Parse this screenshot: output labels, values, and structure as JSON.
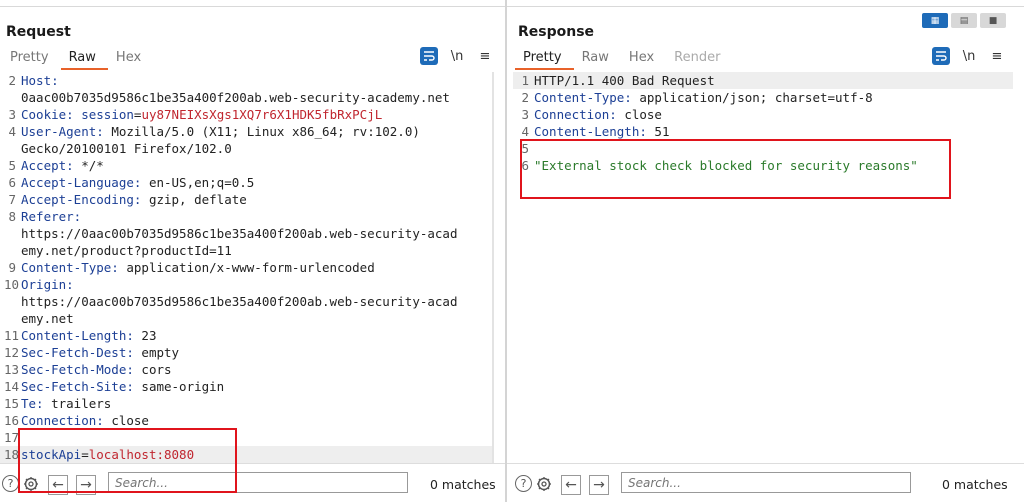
{
  "request": {
    "title": "Request",
    "tabs": [
      "Pretty",
      "Raw",
      "Hex"
    ],
    "active_tab": "Raw",
    "tool_icons": [
      "wrap-icon",
      "newline-icon",
      "menu-icon"
    ],
    "tool_labels": [
      "\\n",
      "≡"
    ],
    "lines": [
      {
        "n": "2",
        "parts": [
          {
            "t": "Host:",
            "c": "k"
          }
        ]
      },
      {
        "n": "",
        "parts": [
          {
            "t": "0aac00b7035d9586c1be35a400f200ab.web-security-academy.net",
            "c": "v"
          }
        ]
      },
      {
        "n": "3",
        "parts": [
          {
            "t": "Cookie:",
            "c": "k"
          },
          {
            "t": " ",
            "c": "v"
          },
          {
            "t": "session",
            "c": "k"
          },
          {
            "t": "=",
            "c": "v"
          },
          {
            "t": "uy87NEIXsXgs1XQ7r6X1HDK5fbRxPCjL",
            "c": "sv"
          }
        ]
      },
      {
        "n": "4",
        "parts": [
          {
            "t": "User-Agent:",
            "c": "k"
          },
          {
            "t": " Mozilla/5.0 (X11; Linux x86_64; rv:102.0)",
            "c": "v"
          }
        ]
      },
      {
        "n": "",
        "parts": [
          {
            "t": "Gecko/20100101 Firefox/102.0",
            "c": "v"
          }
        ]
      },
      {
        "n": "5",
        "parts": [
          {
            "t": "Accept:",
            "c": "k"
          },
          {
            "t": " */*",
            "c": "v"
          }
        ]
      },
      {
        "n": "6",
        "parts": [
          {
            "t": "Accept-Language:",
            "c": "k"
          },
          {
            "t": " en-US,en;q=0.5",
            "c": "v"
          }
        ]
      },
      {
        "n": "7",
        "parts": [
          {
            "t": "Accept-Encoding:",
            "c": "k"
          },
          {
            "t": " gzip, deflate",
            "c": "v"
          }
        ]
      },
      {
        "n": "8",
        "parts": [
          {
            "t": "Referer:",
            "c": "k"
          }
        ]
      },
      {
        "n": "",
        "parts": [
          {
            "t": "https://0aac00b7035d9586c1be35a400f200ab.web-security-acad",
            "c": "v"
          }
        ]
      },
      {
        "n": "",
        "parts": [
          {
            "t": "emy.net/product?productId=11",
            "c": "v"
          }
        ]
      },
      {
        "n": "9",
        "parts": [
          {
            "t": "Content-Type:",
            "c": "k"
          },
          {
            "t": " application/x-www-form-urlencoded",
            "c": "v"
          }
        ]
      },
      {
        "n": "10",
        "parts": [
          {
            "t": "Origin:",
            "c": "k"
          }
        ]
      },
      {
        "n": "",
        "parts": [
          {
            "t": "https://0aac00b7035d9586c1be35a400f200ab.web-security-acad",
            "c": "v"
          }
        ]
      },
      {
        "n": "",
        "parts": [
          {
            "t": "emy.net",
            "c": "v"
          }
        ]
      },
      {
        "n": "11",
        "parts": [
          {
            "t": "Content-Length:",
            "c": "k"
          },
          {
            "t": " 23",
            "c": "v"
          }
        ]
      },
      {
        "n": "12",
        "parts": [
          {
            "t": "Sec-Fetch-Dest:",
            "c": "k"
          },
          {
            "t": " empty",
            "c": "v"
          }
        ]
      },
      {
        "n": "13",
        "parts": [
          {
            "t": "Sec-Fetch-Mode:",
            "c": "k"
          },
          {
            "t": " cors",
            "c": "v"
          }
        ]
      },
      {
        "n": "14",
        "parts": [
          {
            "t": "Sec-Fetch-Site:",
            "c": "k"
          },
          {
            "t": " same-origin",
            "c": "v"
          }
        ]
      },
      {
        "n": "15",
        "parts": [
          {
            "t": "Te:",
            "c": "k"
          },
          {
            "t": " trailers",
            "c": "v"
          }
        ]
      },
      {
        "n": "16",
        "parts": [
          {
            "t": "Connection:",
            "c": "k"
          },
          {
            "t": " close",
            "c": "v"
          }
        ]
      },
      {
        "n": "17",
        "parts": []
      },
      {
        "n": "18",
        "parts": [
          {
            "t": "stockApi",
            "c": "k"
          },
          {
            "t": "=",
            "c": "v"
          },
          {
            "t": "localhost:8080",
            "c": "sv"
          }
        ],
        "highlight": true
      }
    ],
    "search_placeholder": "Search...",
    "matches": "0 matches"
  },
  "response": {
    "title": "Response",
    "tabs": [
      "Pretty",
      "Raw",
      "Hex",
      "Render"
    ],
    "active_tab": "Pretty",
    "lines": [
      {
        "n": "1",
        "parts": [
          {
            "t": "HTTP/1.1 400 Bad Request",
            "c": "v"
          }
        ],
        "highlight": true
      },
      {
        "n": "2",
        "parts": [
          {
            "t": "Content-Type:",
            "c": "k"
          },
          {
            "t": " application/json; charset=utf-8",
            "c": "v"
          }
        ]
      },
      {
        "n": "3",
        "parts": [
          {
            "t": "Connection:",
            "c": "k"
          },
          {
            "t": " close",
            "c": "v"
          }
        ]
      },
      {
        "n": "4",
        "parts": [
          {
            "t": "Content-Length:",
            "c": "k"
          },
          {
            "t": " 51",
            "c": "v"
          }
        ]
      },
      {
        "n": "5",
        "parts": []
      },
      {
        "n": "6",
        "parts": [
          {
            "t": "\"External stock check blocked for security reasons\"",
            "c": "str"
          }
        ]
      }
    ],
    "search_placeholder": "Search...",
    "matches": "0 matches"
  },
  "colors": {
    "accent": "#1e6bb8",
    "active_tab_underline": "#e8622a",
    "annotation_box": "#e0141c"
  }
}
